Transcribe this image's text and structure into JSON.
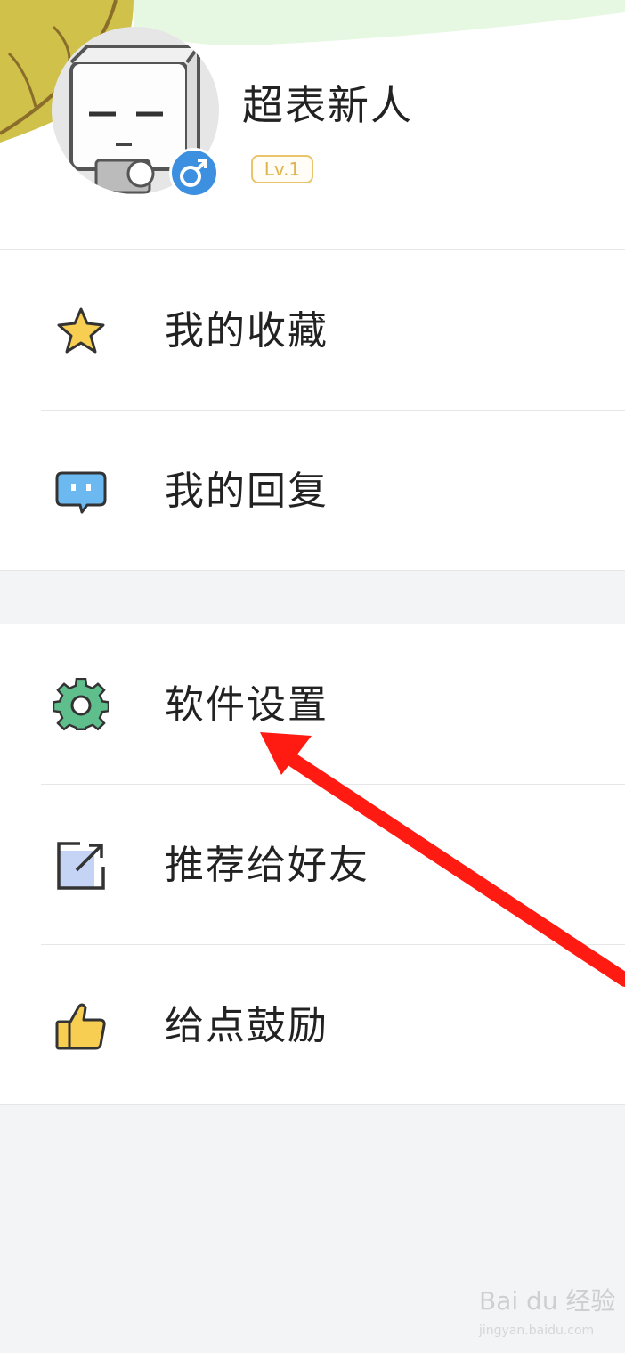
{
  "profile": {
    "username": "超表新人",
    "level": "Lv.1",
    "gender_icon": "male-icon"
  },
  "menu_group_1": [
    {
      "label": "我的收藏",
      "icon": "star-icon"
    },
    {
      "label": "我的回复",
      "icon": "chat-bubble-icon"
    }
  ],
  "menu_group_2": [
    {
      "label": "软件设置",
      "icon": "gear-icon"
    },
    {
      "label": "推荐给好友",
      "icon": "share-icon"
    },
    {
      "label": "给点鼓励",
      "icon": "thumbs-up-icon"
    }
  ],
  "watermark": {
    "brand": "Bai du 经验",
    "url": "jingyan.baidu.com"
  },
  "colors": {
    "accent_blue": "#3d8fe0",
    "level_gold": "#e0b34c",
    "annotation_red": "#ff1a12",
    "gear_green": "#5fbf8c"
  }
}
